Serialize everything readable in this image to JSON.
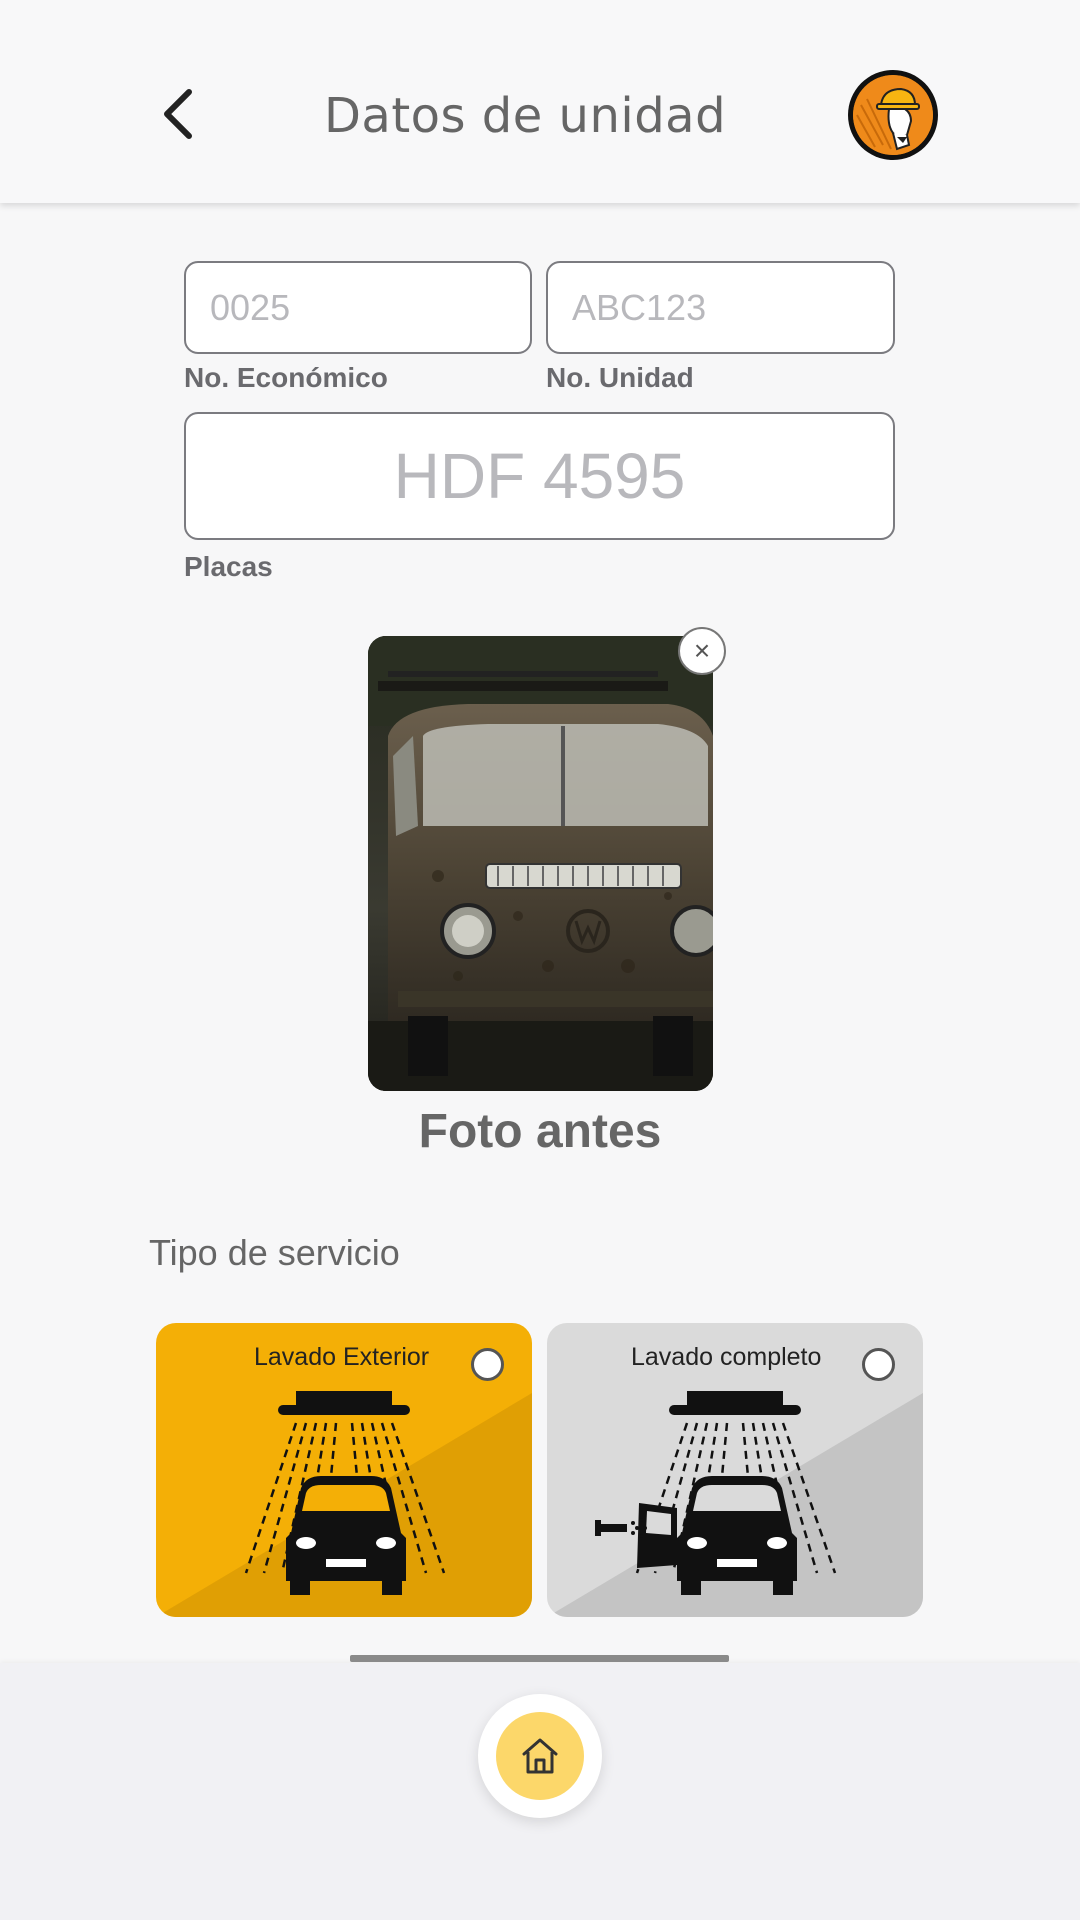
{
  "header": {
    "title": "Datos de unidad",
    "back_icon": "chevron-left-icon",
    "avatar_icon": "worker-hardhat-avatar-icon"
  },
  "form": {
    "economic_number": {
      "value": "0025",
      "label": "No. Económico"
    },
    "unit_number": {
      "value": "ABC123",
      "label": "No. Unidad"
    },
    "plates": {
      "value": "HDF 4595",
      "label": "Placas"
    }
  },
  "photo": {
    "caption": "Foto antes",
    "remove_icon": "close-icon",
    "remove_symbol": "×"
  },
  "service": {
    "section_title": "Tipo de servicio",
    "options": [
      {
        "label": "Lavado Exterior",
        "selected": false,
        "color": "#f4af06"
      },
      {
        "label": "Lavado completo",
        "selected": false,
        "color": "#dadada"
      }
    ]
  },
  "nav": {
    "home_icon": "home-icon"
  },
  "colors": {
    "accent": "#f4af06",
    "home_button": "#fcd76a"
  }
}
